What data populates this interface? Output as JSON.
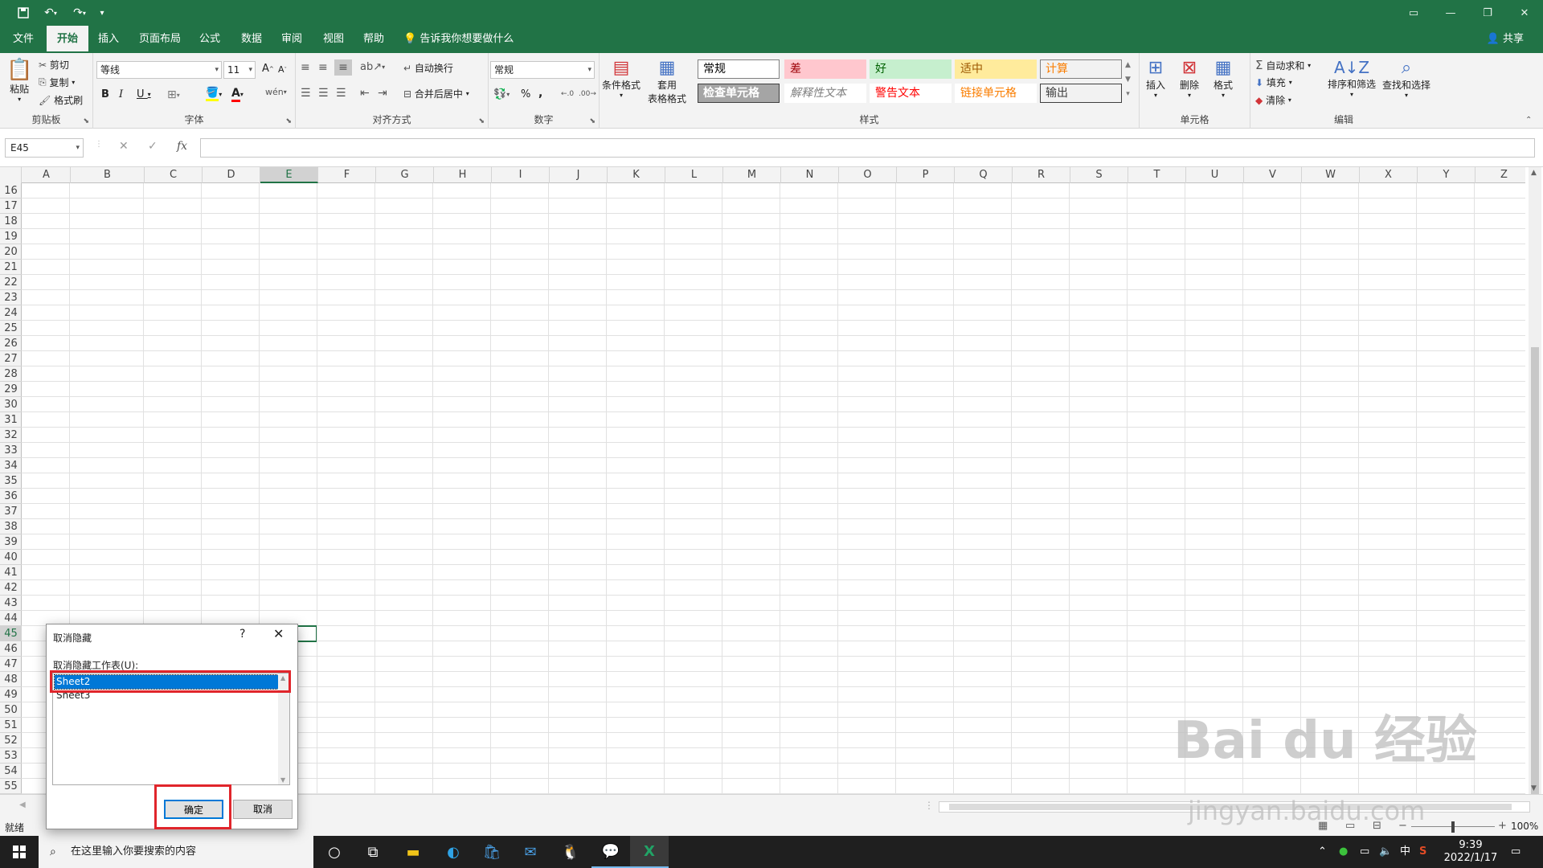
{
  "title_bar": {
    "qa_save_icon": "save-icon",
    "qa_undo_icon": "undo-icon",
    "qa_redo_icon": "redo-icon",
    "qa_customize_icon": "customize-icon"
  },
  "menu": {
    "tabs": [
      "文件",
      "开始",
      "插入",
      "页面布局",
      "公式",
      "数据",
      "审阅",
      "视图",
      "帮助"
    ],
    "active": "开始",
    "tell_me": "告诉我你想要做什么",
    "share": "共享"
  },
  "ribbon": {
    "clipboard": {
      "label": "剪贴板",
      "paste": "粘贴",
      "cut": "剪切",
      "copy": "复制",
      "format_painter": "格式刷"
    },
    "font": {
      "label": "字体",
      "name": "等线",
      "size": "11",
      "bold": "B",
      "italic": "I",
      "underline": "U",
      "font_color": "A"
    },
    "alignment": {
      "label": "对齐方式",
      "wrap": "自动换行",
      "merge": "合并后居中"
    },
    "number": {
      "label": "数字",
      "format": "常规",
      "percent": "%",
      "comma": ","
    },
    "styles": {
      "label": "样式",
      "conditional": "条件格式",
      "table_format_1": "套用",
      "table_format_2": "表格格式",
      "cells": [
        {
          "text": "常规",
          "bg": "#ffffff",
          "fg": "#000000",
          "border": "#808080"
        },
        {
          "text": "差",
          "bg": "#ffc7ce",
          "fg": "#9c0006",
          "border": "#ffc7ce"
        },
        {
          "text": "好",
          "bg": "#c6efce",
          "fg": "#006100",
          "border": "#c6efce"
        },
        {
          "text": "适中",
          "bg": "#ffeb9c",
          "fg": "#9c5700",
          "border": "#ffeb9c"
        },
        {
          "text": "计算",
          "bg": "#f2f2f2",
          "fg": "#fa7d00",
          "border": "#7f7f7f"
        },
        {
          "text": "检查单元格",
          "bg": "#a5a5a5",
          "fg": "#ffffff",
          "border": "#3f3f3f"
        },
        {
          "text": "解释性文本",
          "bg": "#ffffff",
          "fg": "#7f7f7f",
          "border": "#ffffff"
        },
        {
          "text": "警告文本",
          "bg": "#ffffff",
          "fg": "#ff0000",
          "border": "#ffffff"
        },
        {
          "text": "链接单元格",
          "bg": "#ffffff",
          "fg": "#fa7d00",
          "border": "#ffffff"
        },
        {
          "text": "输出",
          "bg": "#f2f2f2",
          "fg": "#3f3f3f",
          "border": "#3f3f3f"
        }
      ]
    },
    "cells_group": {
      "label": "单元格",
      "insert": "插入",
      "delete": "删除",
      "format": "格式"
    },
    "editing": {
      "label": "编辑",
      "autosum": "自动求和",
      "fill": "填充",
      "clear": "清除",
      "sort": "排序和筛选",
      "find": "查找和选择"
    }
  },
  "formula_bar": {
    "name_box": "E45",
    "cancel": "✕",
    "enter": "✓",
    "fx": "fx",
    "content": ""
  },
  "grid": {
    "columns": [
      "A",
      "B",
      "C",
      "D",
      "E",
      "F",
      "G",
      "H",
      "I",
      "J",
      "K",
      "L",
      "M",
      "N",
      "O",
      "P",
      "Q",
      "R",
      "S",
      "T",
      "U",
      "V",
      "W",
      "X",
      "Y",
      "Z"
    ],
    "rows": [
      "16",
      "17",
      "18",
      "19",
      "20",
      "21",
      "22",
      "23",
      "24",
      "25",
      "26",
      "27",
      "28",
      "29",
      "30",
      "31",
      "32",
      "33",
      "34",
      "35",
      "36",
      "37",
      "38",
      "39",
      "40",
      "41",
      "42",
      "43",
      "44",
      "45",
      "46",
      "47",
      "48",
      "49",
      "50",
      "51",
      "52",
      "53",
      "54",
      "55"
    ],
    "selected_column": "E",
    "selected_row": "45"
  },
  "status": {
    "ready": "就绪",
    "zoom": "100%"
  },
  "dialog": {
    "title": "取消隐藏",
    "help": "?",
    "close": "✕",
    "list_label": "取消隐藏工作表(U):",
    "items": [
      "Sheet2",
      "Sheet3"
    ],
    "selected": "Sheet2",
    "ok": "确定",
    "cancel": "取消"
  },
  "taskbar": {
    "search_placeholder": "在这里输入你要搜索的内容",
    "time": "9:39",
    "date": "2022/1/17",
    "ime": "中"
  },
  "watermark": {
    "text": "Bai du 经验",
    "url": "jingyan.baidu.com"
  },
  "colors": {
    "excel_green": "#217346",
    "annotation_red": "#e0252b",
    "selection_blue": "#0078d7"
  }
}
